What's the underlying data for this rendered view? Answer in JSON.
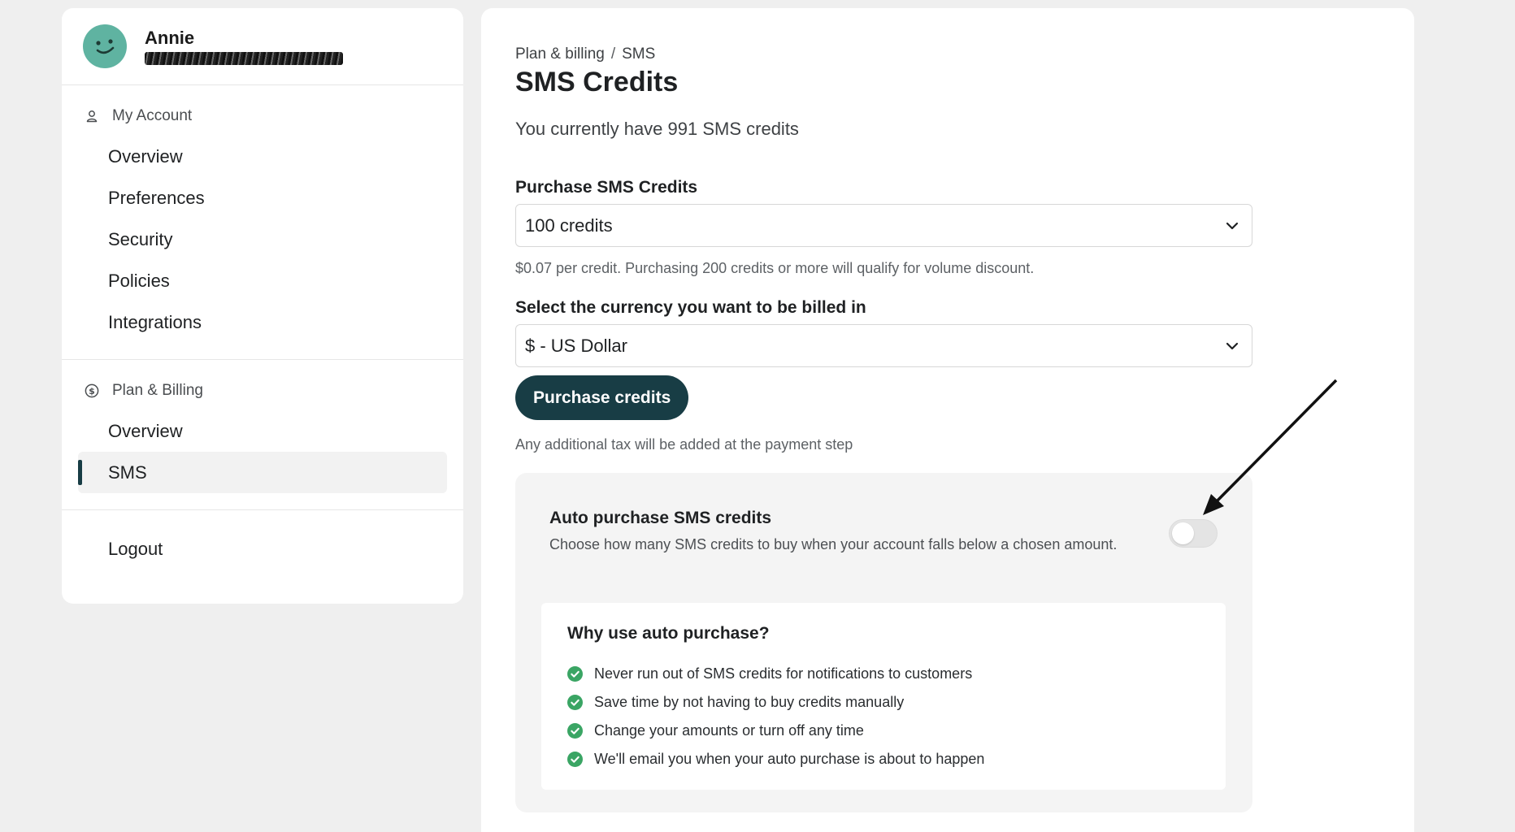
{
  "profile": {
    "name": "Annie"
  },
  "sidebar": {
    "account_section": {
      "title": "My Account",
      "items": [
        {
          "label": "Overview"
        },
        {
          "label": "Preferences"
        },
        {
          "label": "Security"
        },
        {
          "label": "Policies"
        },
        {
          "label": "Integrations"
        }
      ]
    },
    "billing_section": {
      "title": "Plan & Billing",
      "items": [
        {
          "label": "Overview"
        },
        {
          "label": "SMS",
          "active": true
        }
      ]
    },
    "logout_label": "Logout"
  },
  "main": {
    "breadcrumb": {
      "parent": "Plan & billing",
      "separator": "/",
      "current": "SMS"
    },
    "title": "SMS Credits",
    "credit_status": "You currently have 991 SMS credits",
    "purchase": {
      "label": "Purchase SMS Credits",
      "selected": "100 credits",
      "hint": "$0.07 per credit. Purchasing 200 credits or more will qualify for volume discount."
    },
    "currency": {
      "label": "Select the currency you want to be billed in",
      "selected": "$ - US Dollar"
    },
    "purchase_button": "Purchase credits",
    "tax_note": "Any additional tax will be added at the payment step",
    "auto_purchase": {
      "title": "Auto purchase SMS credits",
      "description": "Choose how many SMS credits to buy when your account falls below a chosen amount.",
      "enabled": false,
      "why": {
        "title": "Why use auto purchase?",
        "benefits": [
          "Never run out of SMS credits for notifications to customers",
          "Save time by not having to buy credits manually",
          "Change your amounts or turn off any time",
          "We'll email you when your auto purchase is about to happen"
        ]
      }
    }
  },
  "colors": {
    "brand_dark": "#183d45",
    "check_green": "#3aa564",
    "avatar": "#5fb3a1"
  },
  "icons": {
    "account": "user-icon",
    "billing": "dollar-circle-icon",
    "dropdown": "chevron-down-icon",
    "benefit": "check-circle-icon"
  }
}
